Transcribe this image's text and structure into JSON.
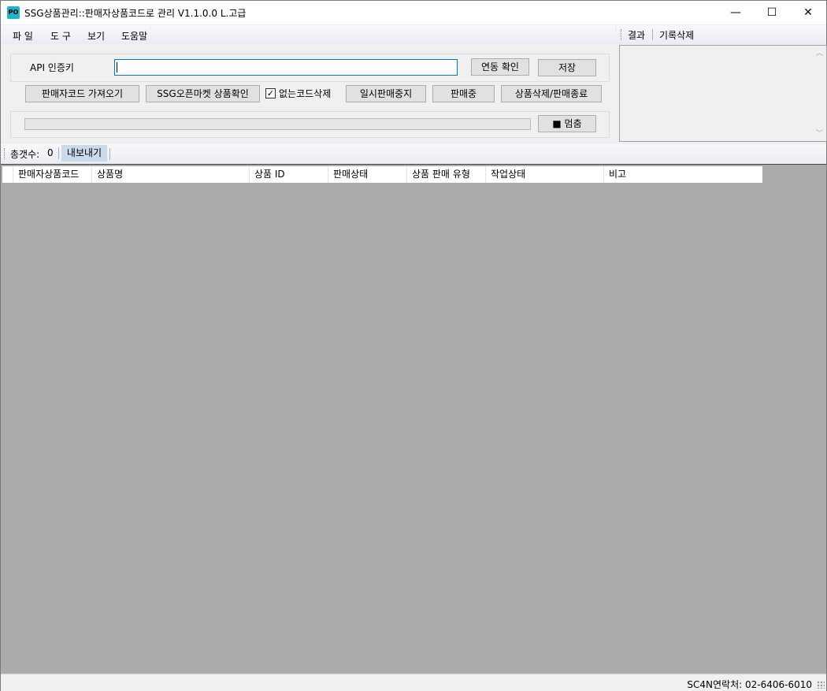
{
  "window": {
    "icon_text": "PO",
    "title": "SSG상품관리::판매자상품코드로 관리  V1.1.0.0 L.고급",
    "minimize": "—",
    "maximize": "☐",
    "close": "✕"
  },
  "menu": [
    "파 일",
    "도 구",
    "보기",
    "도움말"
  ],
  "right_panel": {
    "tabs": [
      "결과",
      "기록삭제"
    ],
    "log_text": ""
  },
  "api": {
    "label": "API 인증키",
    "value": "",
    "check_button": "연동 확인",
    "save_button": "저장"
  },
  "actions": {
    "fetch_button": "판매자코드 가져오기",
    "ssg_check_button": "SSG오픈마켓 상품확인",
    "delete_missing_label": "없는코드삭제",
    "delete_missing_checked": true,
    "pause_button": "일시판매중지",
    "on_sale_button": "판매중",
    "delete_end_button": "상품삭제/판매종료"
  },
  "progress": {
    "value": 0,
    "stop_button": "■ 멈춤"
  },
  "toolbar2": {
    "count_label": "총갯수:",
    "count_value": "0",
    "export_button": "내보내기"
  },
  "grid": {
    "columns": [
      "판매자상품코드",
      "상품명",
      "상품 ID",
      "판매상태",
      "상품 판매 유형",
      "작업상태",
      "비고"
    ],
    "rows": []
  },
  "statusbar": {
    "contact": "SC4N연락처: 02-6406-6010"
  }
}
